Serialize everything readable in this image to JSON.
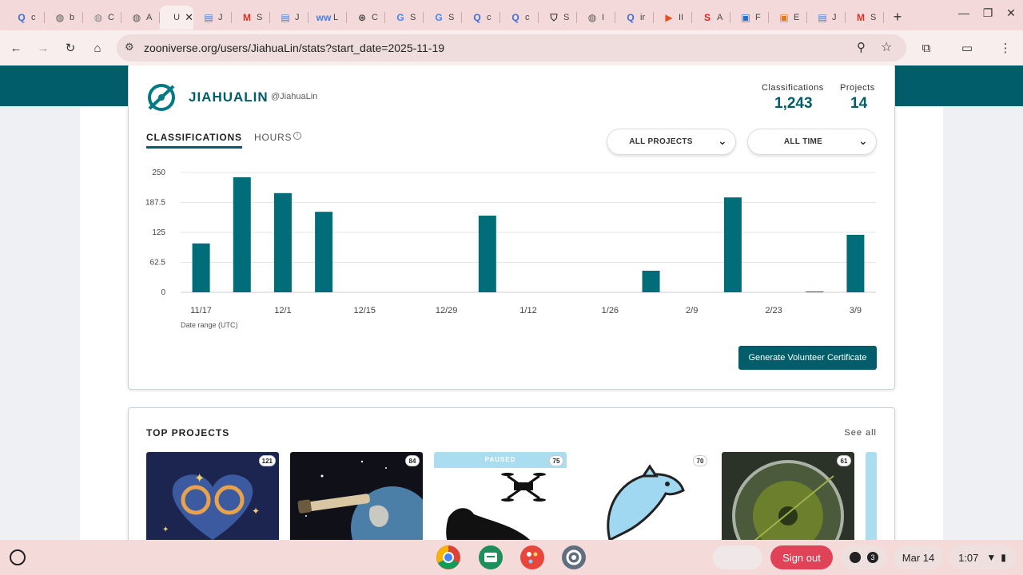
{
  "browser": {
    "tabs": [
      {
        "icon": "search-icon",
        "glyph": "Q",
        "label": "c",
        "color": "#3b6fd6"
      },
      {
        "icon": "globe-icon",
        "glyph": "◍",
        "label": "b",
        "color": "#555"
      },
      {
        "icon": "globe-icon",
        "glyph": "◍",
        "label": "C",
        "color": "#888"
      },
      {
        "icon": "globe-icon",
        "glyph": "◍",
        "label": "A",
        "color": "#555"
      },
      {
        "icon": "zooniverse-icon",
        "glyph": "",
        "label": "U",
        "color": "#333",
        "active": true
      },
      {
        "icon": "docs-icon",
        "glyph": "▤",
        "label": "J",
        "color": "#4a7fe0"
      },
      {
        "icon": "gmail-icon",
        "glyph": "M",
        "label": "S",
        "color": "#d93025"
      },
      {
        "icon": "docs-icon",
        "glyph": "▤",
        "label": "J",
        "color": "#4a7fe0"
      },
      {
        "icon": "site-icon",
        "glyph": "ww",
        "label": "L",
        "color": "#4a7fe0"
      },
      {
        "icon": "chatgpt-icon",
        "glyph": "⊛",
        "label": "C",
        "color": "#444"
      },
      {
        "icon": "google-icon",
        "glyph": "G",
        "label": "S",
        "color": "#4285f4"
      },
      {
        "icon": "google-icon",
        "glyph": "G",
        "label": "S",
        "color": "#4285f4"
      },
      {
        "icon": "search-icon",
        "glyph": "Q",
        "label": "c",
        "color": "#3b6fd6"
      },
      {
        "icon": "search-icon",
        "glyph": "Q",
        "label": "c",
        "color": "#3b6fd6"
      },
      {
        "icon": "shield-icon",
        "glyph": "⛉",
        "label": "S",
        "color": "#333"
      },
      {
        "icon": "globe-icon",
        "glyph": "◍",
        "label": "I",
        "color": "#555"
      },
      {
        "icon": "search-icon",
        "glyph": "Q",
        "label": "ir",
        "color": "#3b6fd6"
      },
      {
        "icon": "play-icon",
        "glyph": "▶",
        "label": "II",
        "color": "#e6521f"
      },
      {
        "icon": "s-logo-icon",
        "glyph": "S",
        "label": "A",
        "color": "#e02020"
      },
      {
        "icon": "profile-icon",
        "glyph": "▣",
        "label": "F",
        "color": "#2a6bd1"
      },
      {
        "icon": "profile-icon",
        "glyph": "▣",
        "label": "E",
        "color": "#e07a22"
      },
      {
        "icon": "docs-icon",
        "glyph": "▤",
        "label": "J",
        "color": "#4a7fe0"
      },
      {
        "icon": "gmail-icon",
        "glyph": "M",
        "label": "S",
        "color": "#d93025"
      }
    ],
    "new_tab": "+",
    "url": "zooniverse.org/users/JiahuaLin/stats?start_date=2025-11-19"
  },
  "profile": {
    "display_name": "JIAHUALIN",
    "handle": "@JiahuaLin",
    "classifications_label": "Classifications",
    "classifications_value": "1,243",
    "projects_label": "Projects",
    "projects_value": "14"
  },
  "stats_tabs": {
    "classifications": "CLASSIFICATIONS",
    "hours": "HOURS",
    "hours_info": "i"
  },
  "filters": {
    "projects": "ALL PROJECTS",
    "time": "ALL TIME"
  },
  "chart_data": {
    "type": "bar",
    "title": "",
    "xlabel": "Date range (UTC)",
    "ylabel": "",
    "ylim": [
      0,
      250
    ],
    "yticks": [
      "250",
      "187.5",
      "125",
      "62.5",
      "0"
    ],
    "ytick_values": [
      250,
      187.5,
      125,
      62.5,
      0
    ],
    "xtick_labels": [
      "11/17",
      "12/1",
      "12/15",
      "12/29",
      "1/12",
      "1/26",
      "2/9",
      "2/23",
      "3/9"
    ],
    "categories": [
      "11/17",
      "11/24",
      "12/1",
      "12/8",
      "12/15",
      "12/22",
      "12/29",
      "1/5",
      "1/12",
      "1/19",
      "1/26",
      "2/2",
      "2/9",
      "2/16",
      "2/23",
      "3/2",
      "3/9"
    ],
    "values": [
      102,
      240,
      207,
      168,
      0,
      0,
      0,
      160,
      0,
      0,
      0,
      45,
      0,
      198,
      0,
      1,
      120
    ],
    "bar_color": "#006d78"
  },
  "certificate_button": "Generate Volunteer Certificate",
  "top_projects": {
    "title": "TOP PROJECTS",
    "see_all": "See all",
    "items": [
      {
        "name": "project-galaxy-heart",
        "count": "121",
        "bg": "#1c2450"
      },
      {
        "name": "project-telescope-earth",
        "count": "84",
        "bg": "#101018"
      },
      {
        "name": "project-iguana-drone",
        "count": "75",
        "bg": "#ffffff",
        "paused": "PAUSED"
      },
      {
        "name": "project-dolphin",
        "count": "70",
        "bg": "#ffffff"
      },
      {
        "name": "project-radar",
        "count": "61",
        "bg": "#2b3328"
      }
    ]
  },
  "shelf": {
    "sign_out": "Sign out",
    "notifications": "3",
    "date": "Mar 14",
    "time": "1:07"
  }
}
